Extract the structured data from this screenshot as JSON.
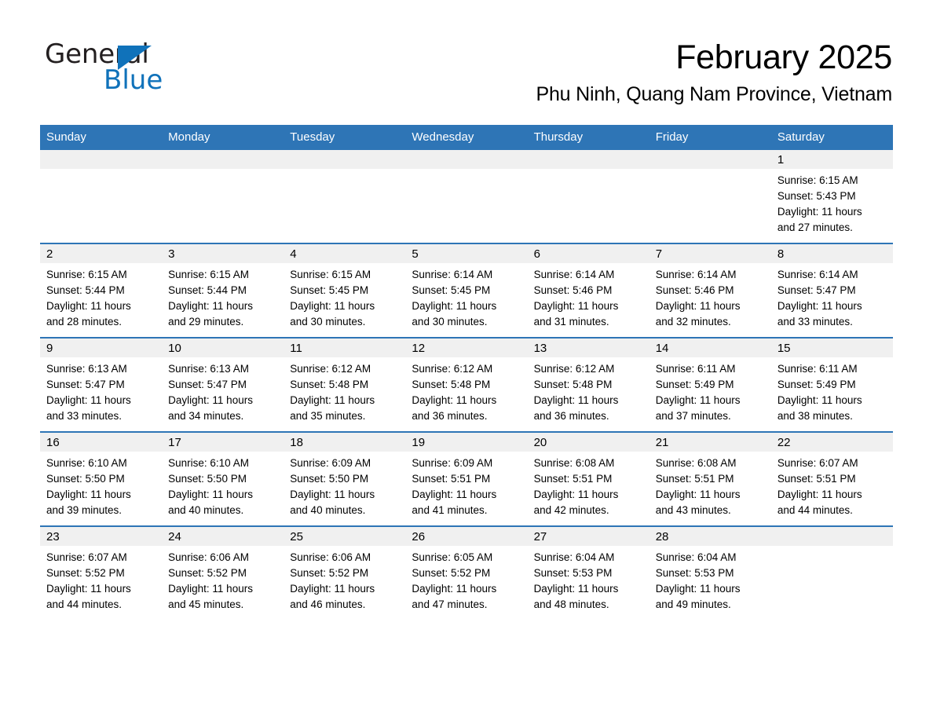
{
  "brand": {
    "name_part1": "General",
    "name_part2": "Blue",
    "accent_color": "#1072ba"
  },
  "header": {
    "month_title": "February 2025",
    "location": "Phu Ninh, Quang Nam Province, Vietnam"
  },
  "theme": {
    "header_blue": "#2e75b6",
    "daynum_band": "#f0f0f0",
    "text": "#000000"
  },
  "weekday_headers": [
    "Sunday",
    "Monday",
    "Tuesday",
    "Wednesday",
    "Thursday",
    "Friday",
    "Saturday"
  ],
  "weeks": [
    [
      {
        "day": "",
        "sunrise": "",
        "sunset": "",
        "daylight_line1": "",
        "daylight_line2": ""
      },
      {
        "day": "",
        "sunrise": "",
        "sunset": "",
        "daylight_line1": "",
        "daylight_line2": ""
      },
      {
        "day": "",
        "sunrise": "",
        "sunset": "",
        "daylight_line1": "",
        "daylight_line2": ""
      },
      {
        "day": "",
        "sunrise": "",
        "sunset": "",
        "daylight_line1": "",
        "daylight_line2": ""
      },
      {
        "day": "",
        "sunrise": "",
        "sunset": "",
        "daylight_line1": "",
        "daylight_line2": ""
      },
      {
        "day": "",
        "sunrise": "",
        "sunset": "",
        "daylight_line1": "",
        "daylight_line2": ""
      },
      {
        "day": "1",
        "sunrise": "Sunrise: 6:15 AM",
        "sunset": "Sunset: 5:43 PM",
        "daylight_line1": "Daylight: 11 hours",
        "daylight_line2": "and 27 minutes."
      }
    ],
    [
      {
        "day": "2",
        "sunrise": "Sunrise: 6:15 AM",
        "sunset": "Sunset: 5:44 PM",
        "daylight_line1": "Daylight: 11 hours",
        "daylight_line2": "and 28 minutes."
      },
      {
        "day": "3",
        "sunrise": "Sunrise: 6:15 AM",
        "sunset": "Sunset: 5:44 PM",
        "daylight_line1": "Daylight: 11 hours",
        "daylight_line2": "and 29 minutes."
      },
      {
        "day": "4",
        "sunrise": "Sunrise: 6:15 AM",
        "sunset": "Sunset: 5:45 PM",
        "daylight_line1": "Daylight: 11 hours",
        "daylight_line2": "and 30 minutes."
      },
      {
        "day": "5",
        "sunrise": "Sunrise: 6:14 AM",
        "sunset": "Sunset: 5:45 PM",
        "daylight_line1": "Daylight: 11 hours",
        "daylight_line2": "and 30 minutes."
      },
      {
        "day": "6",
        "sunrise": "Sunrise: 6:14 AM",
        "sunset": "Sunset: 5:46 PM",
        "daylight_line1": "Daylight: 11 hours",
        "daylight_line2": "and 31 minutes."
      },
      {
        "day": "7",
        "sunrise": "Sunrise: 6:14 AM",
        "sunset": "Sunset: 5:46 PM",
        "daylight_line1": "Daylight: 11 hours",
        "daylight_line2": "and 32 minutes."
      },
      {
        "day": "8",
        "sunrise": "Sunrise: 6:14 AM",
        "sunset": "Sunset: 5:47 PM",
        "daylight_line1": "Daylight: 11 hours",
        "daylight_line2": "and 33 minutes."
      }
    ],
    [
      {
        "day": "9",
        "sunrise": "Sunrise: 6:13 AM",
        "sunset": "Sunset: 5:47 PM",
        "daylight_line1": "Daylight: 11 hours",
        "daylight_line2": "and 33 minutes."
      },
      {
        "day": "10",
        "sunrise": "Sunrise: 6:13 AM",
        "sunset": "Sunset: 5:47 PM",
        "daylight_line1": "Daylight: 11 hours",
        "daylight_line2": "and 34 minutes."
      },
      {
        "day": "11",
        "sunrise": "Sunrise: 6:12 AM",
        "sunset": "Sunset: 5:48 PM",
        "daylight_line1": "Daylight: 11 hours",
        "daylight_line2": "and 35 minutes."
      },
      {
        "day": "12",
        "sunrise": "Sunrise: 6:12 AM",
        "sunset": "Sunset: 5:48 PM",
        "daylight_line1": "Daylight: 11 hours",
        "daylight_line2": "and 36 minutes."
      },
      {
        "day": "13",
        "sunrise": "Sunrise: 6:12 AM",
        "sunset": "Sunset: 5:48 PM",
        "daylight_line1": "Daylight: 11 hours",
        "daylight_line2": "and 36 minutes."
      },
      {
        "day": "14",
        "sunrise": "Sunrise: 6:11 AM",
        "sunset": "Sunset: 5:49 PM",
        "daylight_line1": "Daylight: 11 hours",
        "daylight_line2": "and 37 minutes."
      },
      {
        "day": "15",
        "sunrise": "Sunrise: 6:11 AM",
        "sunset": "Sunset: 5:49 PM",
        "daylight_line1": "Daylight: 11 hours",
        "daylight_line2": "and 38 minutes."
      }
    ],
    [
      {
        "day": "16",
        "sunrise": "Sunrise: 6:10 AM",
        "sunset": "Sunset: 5:50 PM",
        "daylight_line1": "Daylight: 11 hours",
        "daylight_line2": "and 39 minutes."
      },
      {
        "day": "17",
        "sunrise": "Sunrise: 6:10 AM",
        "sunset": "Sunset: 5:50 PM",
        "daylight_line1": "Daylight: 11 hours",
        "daylight_line2": "and 40 minutes."
      },
      {
        "day": "18",
        "sunrise": "Sunrise: 6:09 AM",
        "sunset": "Sunset: 5:50 PM",
        "daylight_line1": "Daylight: 11 hours",
        "daylight_line2": "and 40 minutes."
      },
      {
        "day": "19",
        "sunrise": "Sunrise: 6:09 AM",
        "sunset": "Sunset: 5:51 PM",
        "daylight_line1": "Daylight: 11 hours",
        "daylight_line2": "and 41 minutes."
      },
      {
        "day": "20",
        "sunrise": "Sunrise: 6:08 AM",
        "sunset": "Sunset: 5:51 PM",
        "daylight_line1": "Daylight: 11 hours",
        "daylight_line2": "and 42 minutes."
      },
      {
        "day": "21",
        "sunrise": "Sunrise: 6:08 AM",
        "sunset": "Sunset: 5:51 PM",
        "daylight_line1": "Daylight: 11 hours",
        "daylight_line2": "and 43 minutes."
      },
      {
        "day": "22",
        "sunrise": "Sunrise: 6:07 AM",
        "sunset": "Sunset: 5:51 PM",
        "daylight_line1": "Daylight: 11 hours",
        "daylight_line2": "and 44 minutes."
      }
    ],
    [
      {
        "day": "23",
        "sunrise": "Sunrise: 6:07 AM",
        "sunset": "Sunset: 5:52 PM",
        "daylight_line1": "Daylight: 11 hours",
        "daylight_line2": "and 44 minutes."
      },
      {
        "day": "24",
        "sunrise": "Sunrise: 6:06 AM",
        "sunset": "Sunset: 5:52 PM",
        "daylight_line1": "Daylight: 11 hours",
        "daylight_line2": "and 45 minutes."
      },
      {
        "day": "25",
        "sunrise": "Sunrise: 6:06 AM",
        "sunset": "Sunset: 5:52 PM",
        "daylight_line1": "Daylight: 11 hours",
        "daylight_line2": "and 46 minutes."
      },
      {
        "day": "26",
        "sunrise": "Sunrise: 6:05 AM",
        "sunset": "Sunset: 5:52 PM",
        "daylight_line1": "Daylight: 11 hours",
        "daylight_line2": "and 47 minutes."
      },
      {
        "day": "27",
        "sunrise": "Sunrise: 6:04 AM",
        "sunset": "Sunset: 5:53 PM",
        "daylight_line1": "Daylight: 11 hours",
        "daylight_line2": "and 48 minutes."
      },
      {
        "day": "28",
        "sunrise": "Sunrise: 6:04 AM",
        "sunset": "Sunset: 5:53 PM",
        "daylight_line1": "Daylight: 11 hours",
        "daylight_line2": "and 49 minutes."
      },
      {
        "day": "",
        "sunrise": "",
        "sunset": "",
        "daylight_line1": "",
        "daylight_line2": ""
      }
    ]
  ]
}
